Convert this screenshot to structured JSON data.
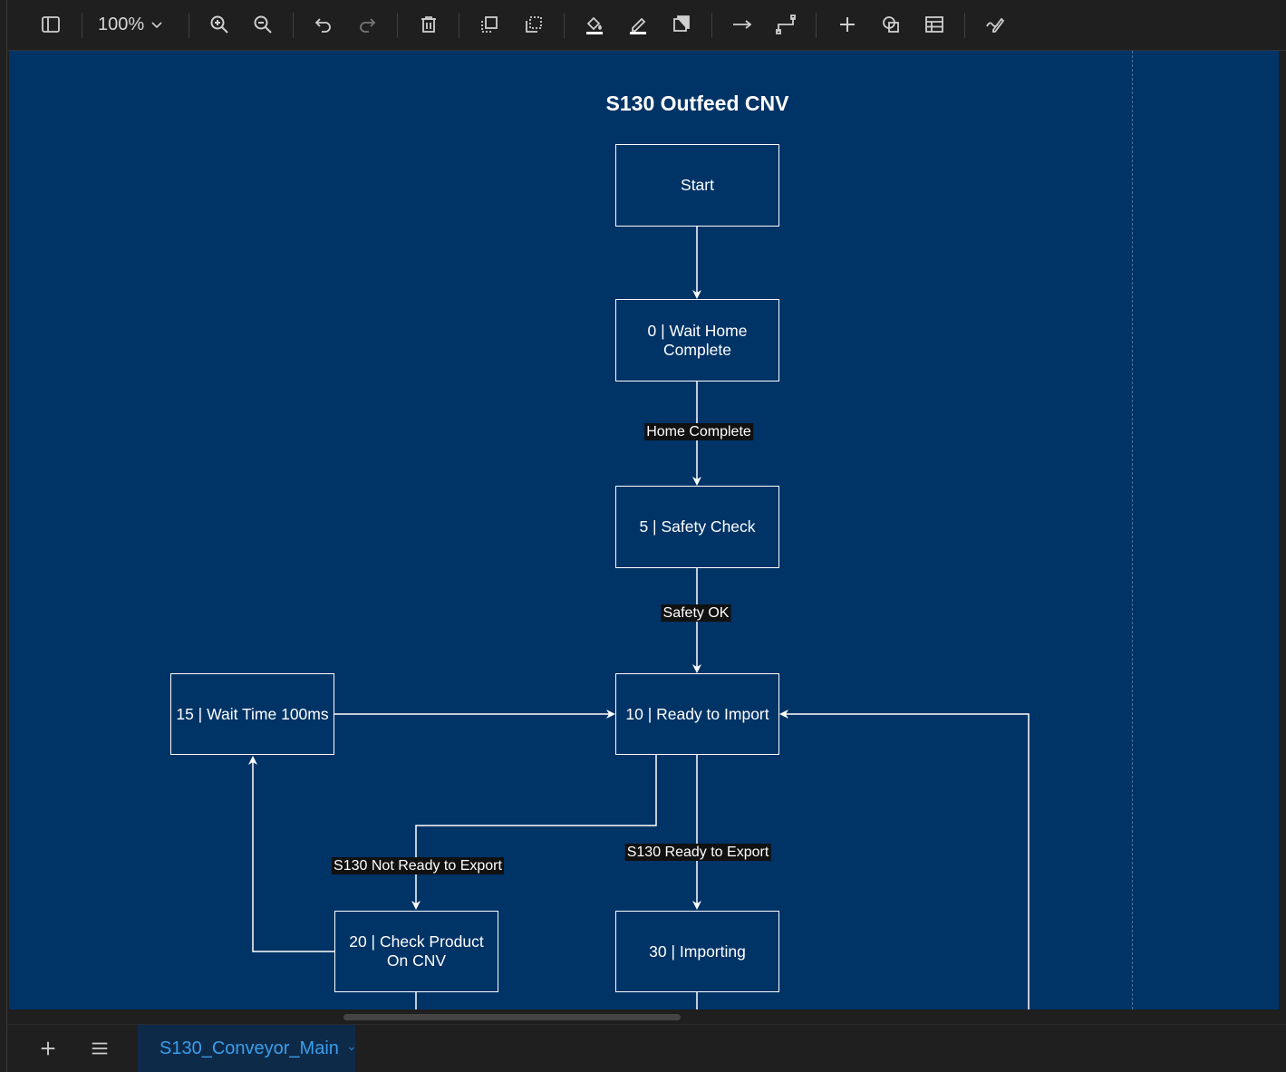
{
  "toolbar": {
    "zoom_level": "100%",
    "icons": [
      "sidebar-icon",
      "zoom-in-icon",
      "zoom-out-icon",
      "undo-icon",
      "redo-icon",
      "delete-icon",
      "bring-to-front-icon",
      "send-to-back-icon",
      "fill-color-icon",
      "line-color-icon",
      "shadow-icon",
      "connection-icon",
      "waypoints-icon",
      "insert-icon",
      "shapes-icon",
      "table-icon",
      "freehand-icon"
    ]
  },
  "diagram": {
    "title": "S130 Outfeed CNV",
    "nodes": {
      "start": "Start",
      "n0": "0 | Wait Home Complete",
      "n5": "5 | Safety Check",
      "n10": "10 | Ready to Import",
      "n15": "15 | Wait Time 100ms",
      "n20": "20 | Check Product On CNV",
      "n30": "30 | Importing"
    },
    "edges": {
      "home_complete": "Home Complete",
      "safety_ok": "Safety OK",
      "not_ready": "S130 Not Ready to Export",
      "ready": "S130 Ready to Export"
    }
  },
  "bottombar": {
    "page_tab": "S130_Conveyor_Main"
  },
  "colors": {
    "canvas": "#003366",
    "chrome": "#1f1f1f",
    "tab_text": "#3b9eea"
  }
}
